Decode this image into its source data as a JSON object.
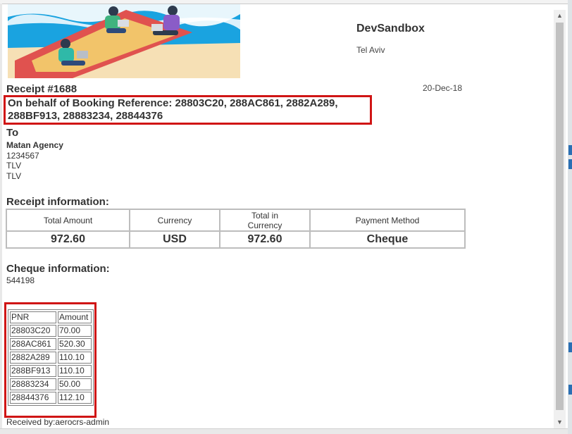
{
  "header": {
    "company_name": "DevSandbox",
    "company_city": "Tel Aviv"
  },
  "receipt": {
    "title": "Receipt #1688",
    "date": "20-Dec-18",
    "booking_ref_line1": "On behalf of Booking Reference: 28803C20, 288AC861, 2882A289,",
    "booking_ref_line2": "288BF913, 28883234, 28844376"
  },
  "recipient": {
    "heading": "To",
    "agency": "Matan Agency",
    "line1": "1234567",
    "line2": "TLV",
    "line3": "TLV"
  },
  "receipt_info": {
    "heading": "Receipt information:",
    "columns": [
      "Total Amount",
      "Currency",
      "Total in Currency",
      "Payment Method"
    ],
    "values": [
      "972.60",
      "USD",
      "972.60",
      "Cheque"
    ]
  },
  "cheque": {
    "heading": "Cheque information:",
    "number": "544198"
  },
  "pnr_table": {
    "headers": [
      "PNR",
      "Amount"
    ],
    "rows": [
      [
        "28803C20",
        "70.00"
      ],
      [
        "288AC861",
        "520.30"
      ],
      [
        "2882A289",
        "110.10"
      ],
      [
        "288BF913",
        "110.10"
      ],
      [
        "28883234",
        "50.00"
      ],
      [
        "28844376",
        "112.10"
      ]
    ]
  },
  "footer": {
    "received_by": "Received by:aerocrs-admin"
  },
  "colors": {
    "highlight_border": "#d01515",
    "banner_sky": "#1aa3e0",
    "sandbox_frame": "#e0524f",
    "sand": "#f2c46a"
  },
  "icons": {
    "scroll_up": "▲",
    "scroll_down": "▼"
  }
}
